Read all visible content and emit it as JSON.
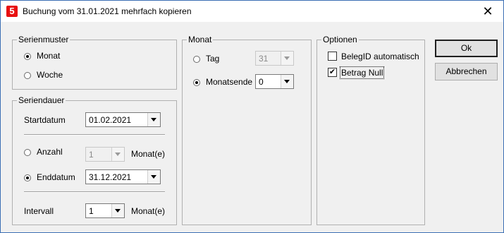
{
  "window": {
    "title": "Buchung vom 31.01.2021 mehrfach kopieren",
    "icon_text": "5",
    "icon_color": "#e81010"
  },
  "serienmuster": {
    "legend": "Serienmuster",
    "options": [
      {
        "label": "Monat",
        "selected": true
      },
      {
        "label": "Woche",
        "selected": false
      }
    ]
  },
  "seriendauer": {
    "legend": "Seriendauer",
    "startdatum_label": "Startdatum",
    "startdatum_value": "01.02.2021",
    "anzahl_label": "Anzahl",
    "anzahl_value": "1",
    "anzahl_unit": "Monat(e)",
    "enddatum_label": "Enddatum",
    "enddatum_value": "31.12.2021",
    "intervall_label": "Intervall",
    "intervall_value": "1",
    "intervall_unit": "Monat(e)"
  },
  "monat": {
    "legend": "Monat",
    "tag_label": "Tag",
    "tag_value": "31",
    "monatsende_label": "Monatsende",
    "monatsende_value": "0"
  },
  "optionen": {
    "legend": "Optionen",
    "belegid_label": "BelegID automatisch",
    "belegid_checked": false,
    "betrag_label": "Betrag Null",
    "betrag_checked": true
  },
  "buttons": {
    "ok": "Ok",
    "abbrechen": "Abbrechen"
  }
}
